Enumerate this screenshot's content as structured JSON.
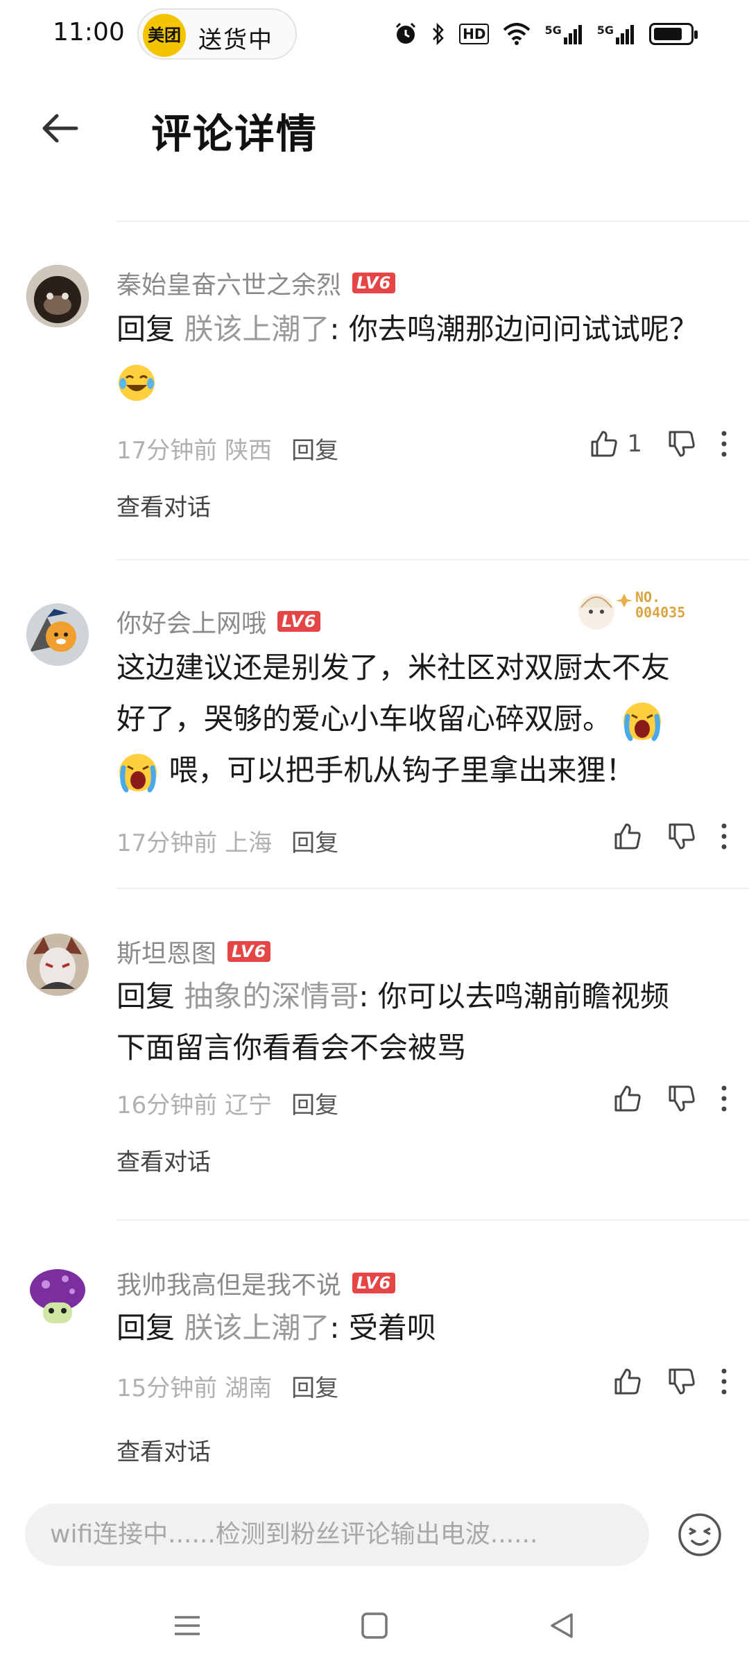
{
  "status_bar": {
    "time": "11:00",
    "pill_logo": "美团",
    "pill_text": "送货中",
    "icons": [
      "alarm-icon",
      "bluetooth-icon",
      "hd-icon",
      "wifi-icon",
      "5g-signal-icon",
      "5g-signal-icon",
      "battery-icon"
    ],
    "hd_label": "HD",
    "fiveg_label_1": "5G",
    "fiveg_label_2": "5G",
    "battery_level": 0.8
  },
  "header": {
    "title": "评论详情",
    "back_icon": "back-arrow-icon"
  },
  "comments": [
    {
      "username": "秦始皇奋六世之余烈",
      "level": "LV6",
      "reply_prefix": "回复 ",
      "reply_to": "朕该上潮了",
      "text": ": 你去鸣潮那边问问试试呢？",
      "emoji": "laughing-tears-emoji",
      "time_loc": "17分钟前 陕西",
      "reply_label": "回复",
      "likes": "1",
      "view_conversation": "查看对话"
    },
    {
      "username": "你好会上网哦",
      "level": "LV6",
      "text_line1": "这边建议还是别发了，米社区对双厨太不友",
      "text_line2": "好了，哭够的爱心小车收留心碎双厨。",
      "text_line3": "喂，可以把手机从钩子里拿出来狸！",
      "emoji": "crying-emoji",
      "decor_badge": "NO.\n004035",
      "time_loc": "17分钟前 上海",
      "reply_label": "回复",
      "likes": ""
    },
    {
      "username": "斯坦恩图",
      "level": "LV6",
      "reply_prefix": "回复 ",
      "reply_to": "抽象的深情哥",
      "text_line1": ": 你可以去鸣潮前瞻视频",
      "text_line2": "下面留言你看看会不会被骂",
      "time_loc": "16分钟前 辽宁",
      "reply_label": "回复",
      "likes": "",
      "view_conversation": "查看对话"
    },
    {
      "username": "我帅我高但是我不说",
      "level": "LV6",
      "reply_prefix": "回复 ",
      "reply_to": "朕该上潮了",
      "text": ": 受着呗",
      "time_loc": "15分钟前 湖南",
      "reply_label": "回复",
      "likes": "",
      "view_conversation": "查看对话"
    }
  ],
  "input": {
    "placeholder": "wifi连接中......检测到粉丝评论输出电波......",
    "emoji_button_icon": "emoji-face-icon"
  },
  "nav_bar": {
    "icons": [
      "menu-icon",
      "home-square-icon",
      "back-triangle-icon"
    ]
  },
  "colors": {
    "level_badge": "#e64545",
    "muted_text": "#8a8a8a",
    "divider": "#eeeeee",
    "meituan_yellow": "#f5c400"
  }
}
